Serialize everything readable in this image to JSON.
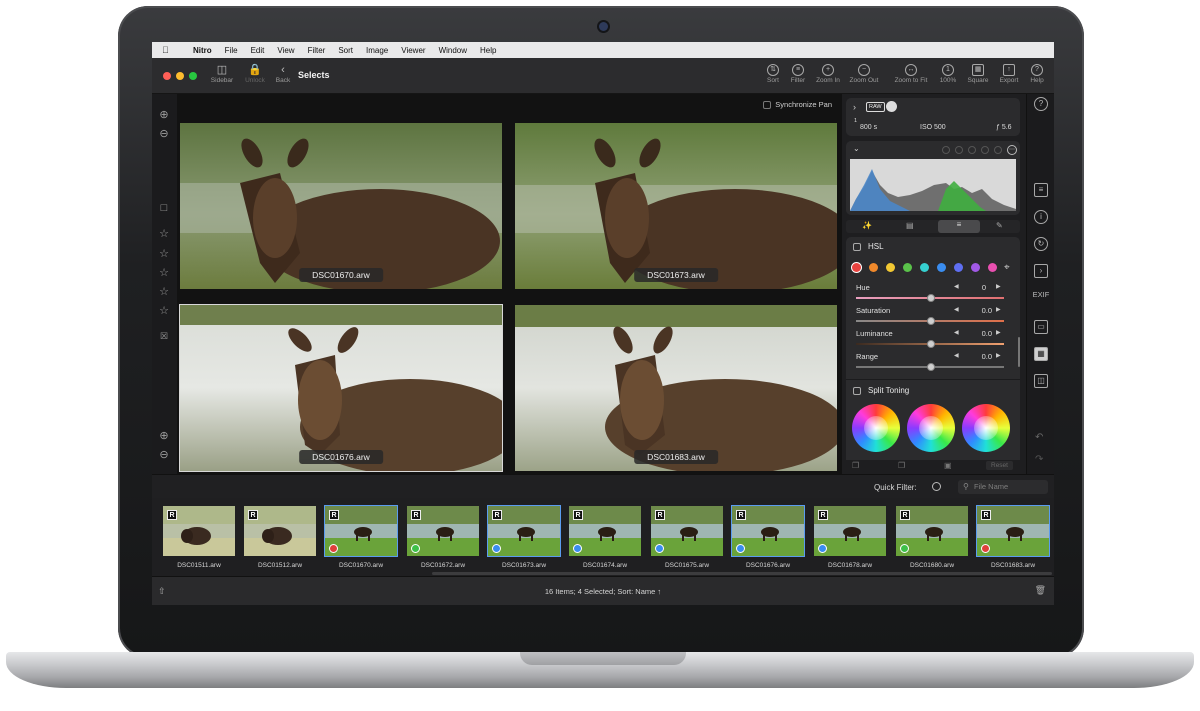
{
  "menubar": {
    "app": "Nitro",
    "items": [
      "File",
      "Edit",
      "View",
      "Filter",
      "Sort",
      "Image",
      "Viewer",
      "Window",
      "Help"
    ]
  },
  "toolbar": {
    "sidebar": "Sidebar",
    "unlock": "Unlock",
    "back": "Back",
    "title": "Selects",
    "right": [
      {
        "label": "Sort",
        "icon": "sort-icon"
      },
      {
        "label": "Filter",
        "icon": "filter-icon"
      },
      {
        "label": "Zoom In",
        "icon": "zoom-in-icon"
      },
      {
        "label": "Zoom Out",
        "icon": "zoom-out-icon"
      },
      {
        "label": "Zoom to Fit",
        "icon": "zoom-fit-icon"
      },
      {
        "label": "100%",
        "icon": "zoom-100-icon"
      },
      {
        "label": "Square",
        "icon": "square-grid-icon"
      },
      {
        "label": "Export",
        "icon": "export-icon"
      },
      {
        "label": "Help",
        "icon": "help-icon"
      }
    ]
  },
  "viewer": {
    "sync_label": "Synchronize Pan",
    "photos": [
      {
        "name": "DSC01670.arw"
      },
      {
        "name": "DSC01673.arw"
      },
      {
        "name": "DSC01676.arw"
      },
      {
        "name": "DSC01683.arw"
      }
    ]
  },
  "inspector": {
    "raw_badge": "RAW",
    "shutter_num": "1",
    "shutter_den": "800 s",
    "iso": "ISO 500",
    "aperture": "ƒ 5.6",
    "hsl_label": "HSL",
    "hue_label": "Hue",
    "hue_value": "0",
    "sat_label": "Saturation",
    "sat_value": "0.0",
    "lum_label": "Luminance",
    "lum_value": "0.0",
    "range_label": "Range",
    "range_value": "0.0",
    "split_label": "Split Toning",
    "reset_label": "Reset",
    "exif_label": "EXIF",
    "swatches": [
      "#e8423f",
      "#f0892b",
      "#f2c833",
      "#5ac24a",
      "#36d0d0",
      "#3a8df0",
      "#5f6ff2",
      "#a159e6",
      "#e94fb0"
    ]
  },
  "quickfilter": {
    "label": "Quick Filter:",
    "placeholder": "File Name"
  },
  "filmstrip": [
    {
      "name": "DSC01511.arw",
      "raw": "R",
      "dot": "",
      "selected": false
    },
    {
      "name": "DSC01512.arw",
      "raw": "R",
      "dot": "",
      "selected": false
    },
    {
      "name": "DSC01670.arw",
      "raw": "R",
      "dot": "#e0403a",
      "selected": true
    },
    {
      "name": "DSC01672.arw",
      "raw": "R",
      "dot": "#3ec14a",
      "selected": false
    },
    {
      "name": "DSC01673.arw",
      "raw": "R",
      "dot": "#3a8df0",
      "selected": true
    },
    {
      "name": "DSC01674.arw",
      "raw": "R",
      "dot": "#3a8df0",
      "selected": false
    },
    {
      "name": "DSC01675.arw",
      "raw": "R",
      "dot": "#3a8df0",
      "selected": false
    },
    {
      "name": "DSC01676.arw",
      "raw": "R",
      "dot": "#3a8df0",
      "selected": true
    },
    {
      "name": "DSC01678.arw",
      "raw": "R",
      "dot": "#3a8df0",
      "selected": false
    },
    {
      "name": "DSC01680.arw",
      "raw": "R",
      "dot": "#3ec14a",
      "selected": false
    },
    {
      "name": "DSC01683.arw",
      "raw": "R",
      "dot": "#e0403a",
      "selected": true
    }
  ],
  "status": {
    "text": "16 Items; 4 Selected; Sort: Name ↑"
  }
}
